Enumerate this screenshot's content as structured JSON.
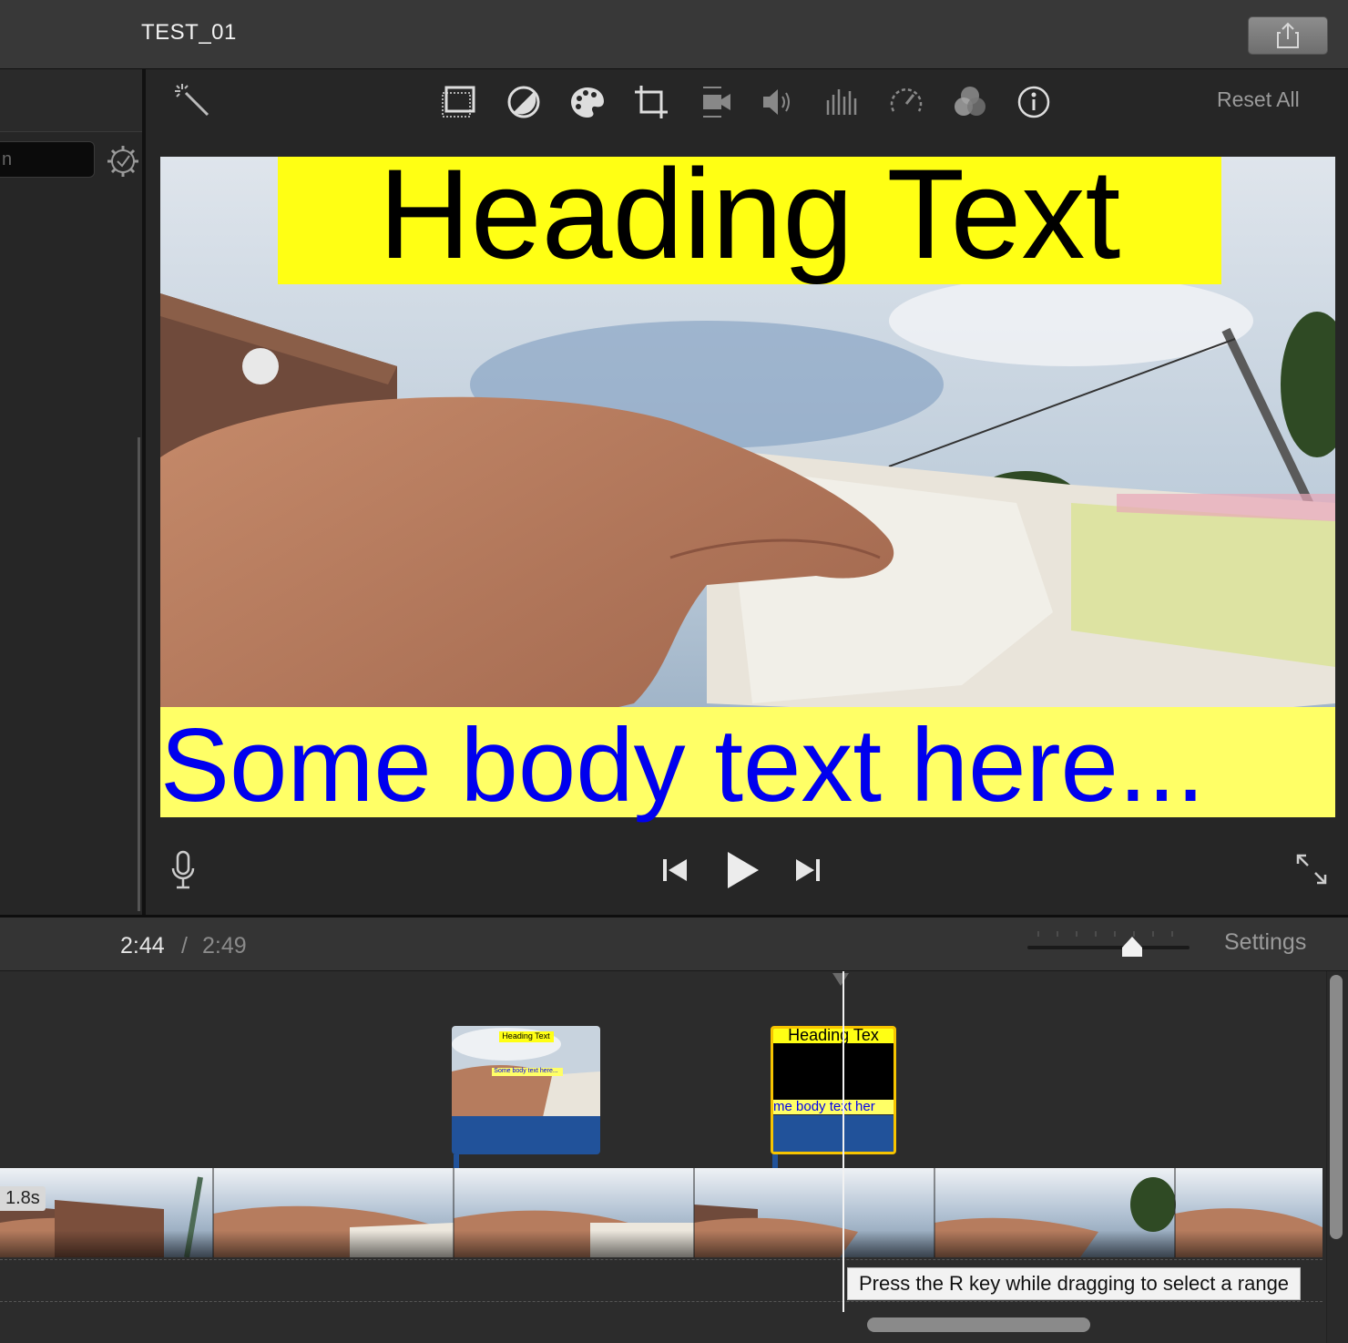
{
  "window": {
    "project_title": "TEST_01",
    "share_icon": "share-icon"
  },
  "browser": {
    "search_placeholder": "n",
    "gear_icon": "gear-icon"
  },
  "viewer_toolbar": {
    "magic_wand_icon": "magic-wand-icon",
    "tools": [
      "crop-to-fill-icon",
      "color-balance-icon",
      "color-correction-icon",
      "crop-icon",
      "stabilization-icon",
      "volume-icon",
      "noise-reduction-icon",
      "speed-icon",
      "clip-filter-icon",
      "info-icon"
    ],
    "reset_all": "Reset All"
  },
  "viewer": {
    "heading": "Heading Text",
    "body": "Some body text here...",
    "heading_bg": "#ffff14",
    "body_bg": "#ffff66",
    "body_color": "#0000ee"
  },
  "playback": {
    "mic_icon": "microphone-icon",
    "prev_icon": "skip-back-icon",
    "play_icon": "play-icon",
    "next_icon": "skip-forward-icon",
    "fullscreen_icon": "fullscreen-icon"
  },
  "timeline_header": {
    "current_time": "2:44",
    "separator": "/",
    "total_time": "2:49",
    "settings": "Settings"
  },
  "timeline": {
    "title_clip_1": {
      "heading": "Heading Text",
      "body": "Some body text here..."
    },
    "title_clip_2": {
      "heading": "Heading Tex",
      "body": "me body text her"
    },
    "duration_badge": "1.8s",
    "tooltip": "Press the R key while dragging to select a range"
  }
}
